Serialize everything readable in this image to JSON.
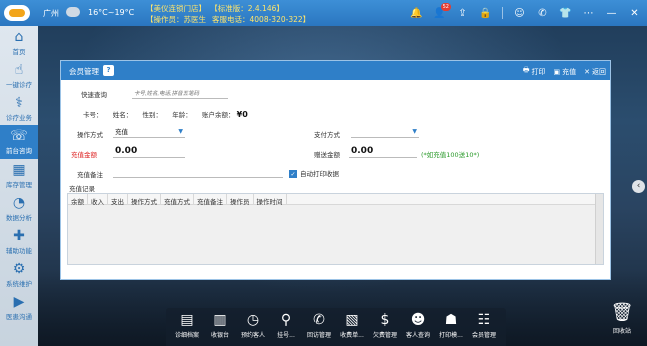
{
  "topbar": {
    "city": "广州",
    "weather_icon": "cloud-icon",
    "temperature": "16°C~19°C",
    "store": "【美仪连锁门店】",
    "version": "【标准版：2.4.146】",
    "operator": "【操作员：苏医生",
    "phone": "客服电话：4008-320-322】",
    "badge_count": "52"
  },
  "sidebar": {
    "items": [
      {
        "label": "首页",
        "icon": "home-icon"
      },
      {
        "label": "一键诊疗",
        "icon": "hand-icon"
      },
      {
        "label": "诊疗业务",
        "icon": "doctor-icon"
      },
      {
        "label": "前台咨询",
        "icon": "reception-icon"
      },
      {
        "label": "库存管理",
        "icon": "inventory-icon"
      },
      {
        "label": "数据分析",
        "icon": "chart-icon"
      },
      {
        "label": "辅助功能",
        "icon": "tools-icon"
      },
      {
        "label": "系统维护",
        "icon": "settings-icon"
      },
      {
        "label": "医患沟通",
        "icon": "video-icon"
      }
    ]
  },
  "panel": {
    "title": "会员管理",
    "help": "?",
    "print": "打印",
    "recharge": "充值",
    "back": "返回",
    "quick_search_label": "快速查询",
    "quick_search_placeholder": "卡号,姓名,电话,拼音五笔码",
    "card_no": "卡号：",
    "name": "姓名：",
    "gender": "性别：",
    "age": "年龄：",
    "balance_label": "账户余额：",
    "balance_value": "¥0",
    "op_type_label": "操作方式",
    "op_type_value": "充值",
    "pay_type_label": "支付方式",
    "pay_type_value": "",
    "recharge_amount_label": "充值金额",
    "recharge_amount_value": "0.00",
    "gift_amount_label": "赠送金额",
    "gift_amount_value": "0.00",
    "gift_note": "(*如充值100送10*)",
    "remark_label": "充值备注",
    "auto_print_label": "自动打印收据",
    "records_title": "充值记录",
    "columns": [
      "余额",
      "收入",
      "支出",
      "操作方式",
      "充值方式",
      "充值备注",
      "操作员",
      "操作时间"
    ]
  },
  "dock": {
    "items": [
      {
        "label": "诊细档案",
        "icon": "id-card-icon"
      },
      {
        "label": "收银台",
        "icon": "cash-icon"
      },
      {
        "label": "预约客人",
        "icon": "appointment-icon"
      },
      {
        "label": "挂号...",
        "icon": "register-icon"
      },
      {
        "label": "回访管理",
        "icon": "call-icon"
      },
      {
        "label": "收费单...",
        "icon": "bill-icon"
      },
      {
        "label": "欠费管理",
        "icon": "money-bag-icon"
      },
      {
        "label": "客人查询",
        "icon": "search-person-icon"
      },
      {
        "label": "打印模...",
        "icon": "print-template-icon"
      },
      {
        "label": "会员管理",
        "icon": "member-icon"
      }
    ],
    "recycle_label": "回收站"
  }
}
